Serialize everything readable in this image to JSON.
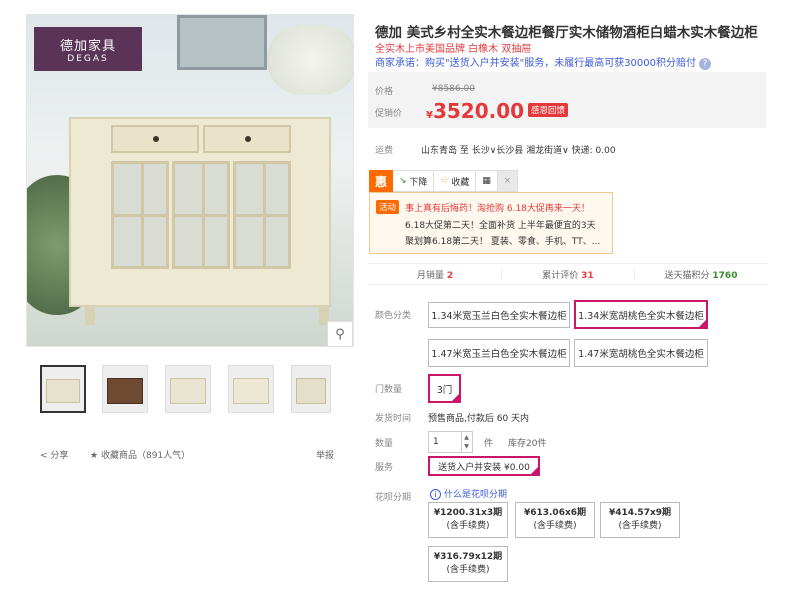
{
  "brand_logo": {
    "cn": "德加家具",
    "en": "DEGAS"
  },
  "product": {
    "title": "德加 美式乡村全实木餐边柜餐厅实木储物酒柜白蜡木实木餐边柜",
    "subtitle": "全实木上市美国品牌 白橡木 双抽屉",
    "promise": "商家承诺：购买\"送货入户并安装\"服务，未履行最高可获30000积分赔付"
  },
  "price": {
    "orig_label": "价格",
    "orig_value": "¥8586.00",
    "cur_label": "促销价",
    "currency": "¥",
    "cur_value": "3520.00",
    "tag": "感恩回馈"
  },
  "shipping": {
    "label": "运费",
    "text": "山东青岛 至 长沙∨长沙县 湘龙街道∨ 快递: 0.00"
  },
  "actions": {
    "hui": "惠",
    "down": "下降",
    "fav": "收藏",
    "compare": "",
    "close": "×"
  },
  "promo": {
    "tag": "活动",
    "line1": "事上真有后悔药！淘抢购 6.18大促再来一天！",
    "line2": "6.18大促第二天！全面补货 上半年最便宜的3天",
    "line3": "聚划算6.18第二天！ 夏装、零食、手机、TT、..."
  },
  "stats": [
    {
      "label": "月销量",
      "value": "2"
    },
    {
      "label": "累计评价",
      "value": "31"
    },
    {
      "label": "送天猫积分",
      "value": "1760"
    }
  ],
  "color": {
    "label": "颜色分类",
    "options": [
      "1.34米宽玉兰白色全实木餐边柜",
      "1.34米宽胡桃色全实木餐边柜",
      "1.47米宽玉兰白色全实木餐边柜",
      "1.47米宽胡桃色全实木餐边柜"
    ],
    "selected": 1
  },
  "doors": {
    "label": "门数量",
    "option": "3门"
  },
  "ship_time": {
    "label": "发货时间",
    "text": "预售商品,付款后 60 天内"
  },
  "quantity": {
    "label": "数量",
    "value": "1",
    "unit": "件",
    "stock": "库存20件"
  },
  "service": {
    "label": "服务",
    "option": "送货入户并安装 ¥0.00"
  },
  "huabei": {
    "label": "花呗分期",
    "link": "什么是花呗分期",
    "plans": [
      {
        "amount": "¥1200.31x3期",
        "note": "(含手续费)"
      },
      {
        "amount": "¥613.06x6期",
        "note": "(含手续费)"
      },
      {
        "amount": "¥414.57x9期",
        "note": "(含手续费)"
      },
      {
        "amount": "¥316.79x12期",
        "note": "(含手续费)"
      }
    ]
  },
  "share_row": {
    "share": "分享",
    "fav": "收藏商品",
    "fav_count": "（891人气）",
    "report": "举报"
  },
  "colors": {
    "accent": "#e4393c",
    "select": "#c9156a",
    "brand": "#5a3457",
    "blue": "#3c5bd6",
    "orange": "#ff6a00"
  }
}
